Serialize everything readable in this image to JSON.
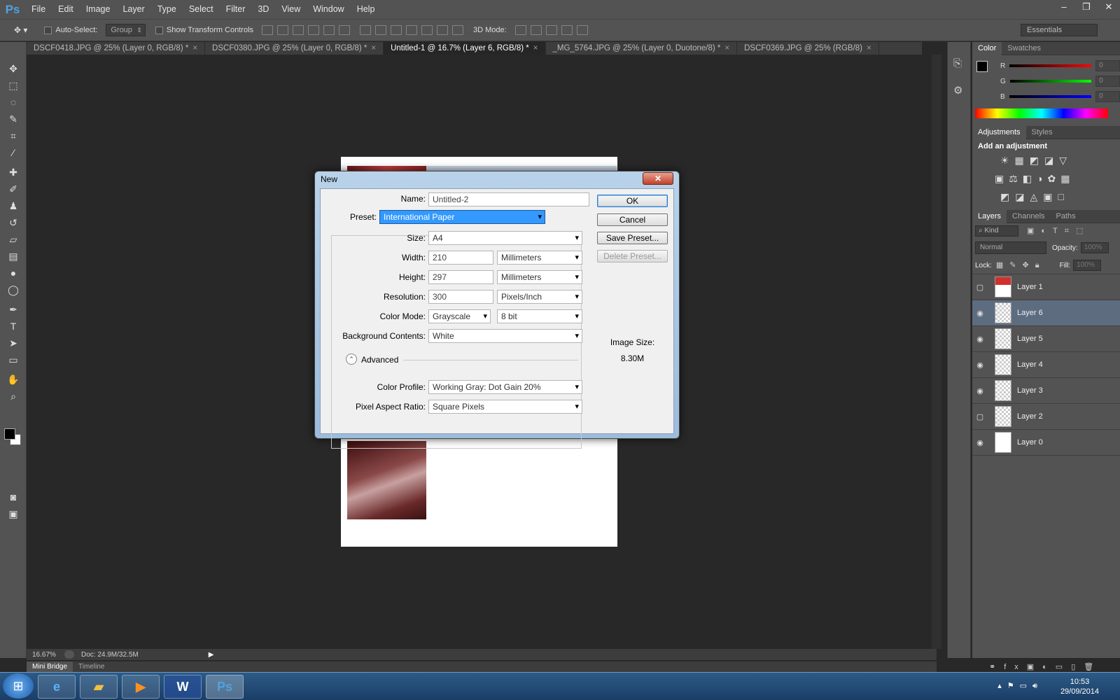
{
  "app": {
    "logo": "Ps"
  },
  "menu": [
    "File",
    "Edit",
    "Image",
    "Layer",
    "Type",
    "Select",
    "Filter",
    "3D",
    "View",
    "Window",
    "Help"
  ],
  "window_controls": {
    "minimize": "–",
    "restore": "❐",
    "close": "✕"
  },
  "options_bar": {
    "auto_select_label": "Auto-Select:",
    "group_value": "Group",
    "transform_label": "Show Transform Controls",
    "mode3d_label": "3D Mode:",
    "workspace": "Essentials"
  },
  "tabs": [
    {
      "label": "DSCF0418.JPG @ 25% (Layer 0, RGB/8) *",
      "close": "×"
    },
    {
      "label": "DSCF0380.JPG @ 25% (Layer 0, RGB/8) *",
      "close": "×"
    },
    {
      "label": "Untitled-1 @ 16.7% (Layer 6, RGB/8) *",
      "close": "×"
    },
    {
      "label": "_MG_5764.JPG @ 25% (Layer 0, Duotone/8) *",
      "close": "×"
    },
    {
      "label": "DSCF0369.JPG @ 25% (RGB/8)",
      "close": "×"
    }
  ],
  "status": {
    "zoom": "16.67%",
    "doc": "Doc: 24.9M/32.5M"
  },
  "bottom_tabs": [
    "Mini Bridge",
    "Timeline"
  ],
  "color_panel": {
    "tabs": [
      "Color",
      "Swatches"
    ],
    "r_label": "R",
    "g_label": "G",
    "b_label": "B",
    "r": "0",
    "g": "0",
    "b": "0"
  },
  "adjust_panel": {
    "tabs": [
      "Adjustments",
      "Styles"
    ],
    "title": "Add an adjustment"
  },
  "layers_panel": {
    "tabs": [
      "Layers",
      "Channels",
      "Paths"
    ],
    "kind": "Kind",
    "blend": "Normal",
    "opacity_label": "Opacity:",
    "opacity": "100%",
    "lock_label": "Lock:",
    "fill_label": "Fill:",
    "fill": "100%",
    "layers": [
      {
        "name": "Layer 1",
        "visible": false
      },
      {
        "name": "Layer 6",
        "visible": true,
        "selected": true
      },
      {
        "name": "Layer 5",
        "visible": true
      },
      {
        "name": "Layer 4",
        "visible": true
      },
      {
        "name": "Layer 3",
        "visible": true
      },
      {
        "name": "Layer 2",
        "visible": false
      },
      {
        "name": "Layer 0",
        "visible": true
      }
    ]
  },
  "dialog": {
    "title": "New",
    "close": "✕",
    "name_label": "Name:",
    "name": "Untitled-2",
    "preset_label": "Preset:",
    "preset": "International Paper",
    "size_label": "Size:",
    "size": "A4",
    "width_label": "Width:",
    "width": "210",
    "width_unit": "Millimeters",
    "height_label": "Height:",
    "height": "297",
    "height_unit": "Millimeters",
    "resolution_label": "Resolution:",
    "resolution": "300",
    "resolution_unit": "Pixels/Inch",
    "color_mode_label": "Color Mode:",
    "color_mode": "Grayscale",
    "bit_depth": "8 bit",
    "bg_label": "Background Contents:",
    "bg": "White",
    "advanced_label": "Advanced",
    "profile_label": "Color Profile:",
    "profile": "Working Gray:  Dot Gain 20%",
    "aspect_label": "Pixel Aspect Ratio:",
    "aspect": "Square Pixels",
    "ok": "OK",
    "cancel": "Cancel",
    "save_preset": "Save Preset...",
    "delete_preset": "Delete Preset...",
    "image_size_label": "Image Size:",
    "image_size": "8.30M"
  },
  "taskbar": {
    "time": "10:53",
    "date": "29/09/2014"
  }
}
